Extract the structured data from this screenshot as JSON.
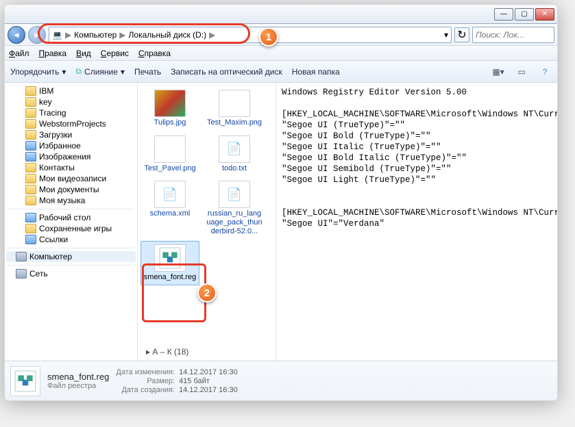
{
  "window": {
    "min": "—",
    "max": "▢",
    "close": "✕"
  },
  "nav": {
    "root_icon": "💻",
    "crumb1": "Компьютер",
    "crumb2": "Локальный диск (D:)",
    "sep": "▶",
    "search_placeholder": "Поиск: Лок...",
    "refresh": "↻",
    "dropdown": "▾"
  },
  "menu": {
    "file": "Файл",
    "edit": "Правка",
    "view": "Вид",
    "tools": "Сервис",
    "help": "Справка"
  },
  "toolbar": {
    "organize": "Упорядочить",
    "merge": "Слияние",
    "print": "Печать",
    "burn": "Записать на оптический диск",
    "newfolder": "Новая папка",
    "dd": "▾"
  },
  "tree": [
    {
      "label": "IBM",
      "cls": ""
    },
    {
      "label": "key",
      "cls": ""
    },
    {
      "label": "Tracing",
      "cls": ""
    },
    {
      "label": "WebstormProjects",
      "cls": ""
    },
    {
      "label": "Загрузки",
      "cls": ""
    },
    {
      "label": "Избранное",
      "cls": ""
    },
    {
      "label": "Изображения",
      "cls": ""
    },
    {
      "label": "Контакты",
      "cls": ""
    },
    {
      "label": "Мои видеозаписи",
      "cls": ""
    },
    {
      "label": "Мои документы",
      "cls": ""
    },
    {
      "label": "Моя музыка",
      "cls": ""
    },
    {
      "label": "Рабочий стол",
      "cls": ""
    },
    {
      "label": "Сохраненные игры",
      "cls": ""
    },
    {
      "label": "Ссылки",
      "cls": ""
    }
  ],
  "tree_tail": {
    "computer": "Компьютер",
    "network": "Сеть"
  },
  "files": {
    "f1": "Tulips.jpg",
    "f2": "Test_Maxim.png",
    "f3": "Test_Pavel.png",
    "f4": "todo.txt",
    "f5": "schema.xml",
    "f6": "russian_ru_language_pack_thunderbird-52.0...",
    "f7": "smena_font.reg",
    "group": "А – К (18)",
    "group_arrow": "▸"
  },
  "preview_text": "Windows Registry Editor Version 5.00\n\n[HKEY_LOCAL_MACHINE\\SOFTWARE\\Microsoft\\Windows NT\\CurrentVersion\\Fonts]\n\"Segoe UI (TrueType)\"=\"\"\n\"Segoe UI Bold (TrueType)\"=\"\"\n\"Segoe UI Italic (TrueType)\"=\"\"\n\"Segoe UI Bold Italic (TrueType)\"=\"\"\n\"Segoe UI Semibold (TrueType)\"=\"\"\n\"Segoe UI Light (TrueType)\"=\"\"\n\n\n[HKEY_LOCAL_MACHINE\\SOFTWARE\\Microsoft\\Windows NT\\CurrentVersion\\FontSubstitutes]\n\"Segoe UI\"=\"Verdana\"",
  "details": {
    "filename": "smena_font.reg",
    "filetype": "Файл реестра",
    "k_modified": "Дата изменения:",
    "v_modified": "14.12.2017 16:30",
    "k_size": "Размер:",
    "v_size": "415 байт",
    "k_created": "Дата создания:",
    "v_created": "14.12.2017 16:30"
  },
  "badges": {
    "one": "1",
    "two": "2"
  }
}
